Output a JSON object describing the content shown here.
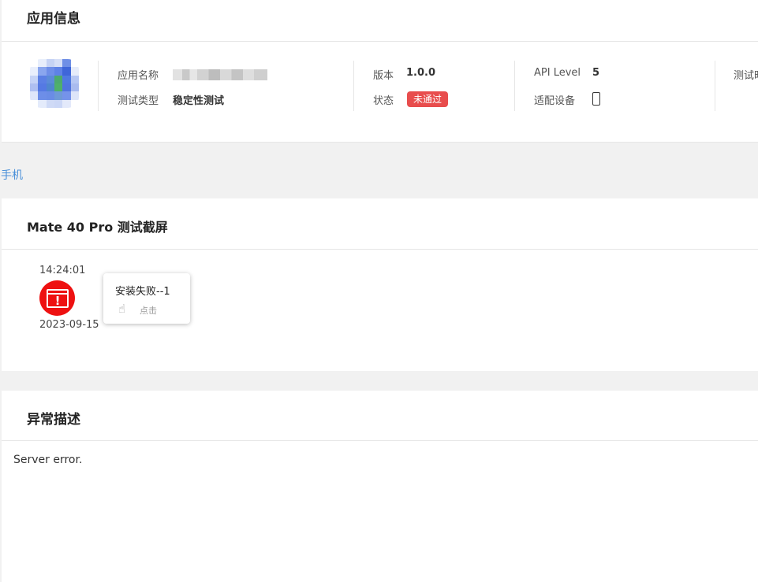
{
  "app_info": {
    "title": "应用信息",
    "fields": {
      "app_name_label": "应用名称",
      "test_type_label": "测试类型",
      "test_type_value": "稳定性测试",
      "version_label": "版本",
      "version_value": "1.0.0",
      "status_label": "状态",
      "status_value": "未通过",
      "api_level_label": "API Level",
      "api_level_value": "5",
      "device_label": "适配设备",
      "test_time_label_partial": "测试时"
    }
  },
  "device_link": "手机",
  "screenshots": {
    "title": "Mate 40 Pro 测试截屏",
    "items": [
      {
        "time": "14:24:01",
        "date": "2023-09-15",
        "popup_title": "安装失败--1",
        "popup_action": "点击"
      }
    ]
  },
  "exception": {
    "title": "异常描述",
    "text": "Server error."
  },
  "colors": {
    "link": "#4a90d9",
    "fail_badge": "#e84d4d",
    "error_icon": "#ee1111"
  }
}
